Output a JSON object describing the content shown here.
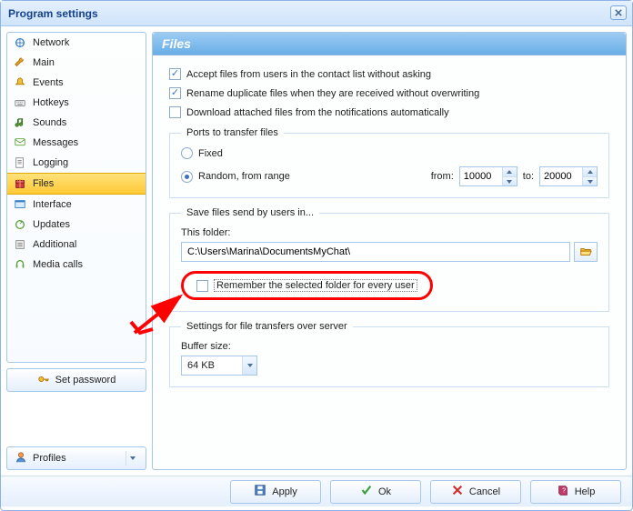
{
  "window": {
    "title": "Program settings"
  },
  "sidebar": {
    "items": [
      {
        "label": "Network"
      },
      {
        "label": "Main"
      },
      {
        "label": "Events"
      },
      {
        "label": "Hotkeys"
      },
      {
        "label": "Sounds"
      },
      {
        "label": "Messages"
      },
      {
        "label": "Logging"
      },
      {
        "label": "Files"
      },
      {
        "label": "Interface"
      },
      {
        "label": "Updates"
      },
      {
        "label": "Additional"
      },
      {
        "label": "Media calls"
      }
    ],
    "set_password": "Set password",
    "profiles": "Profiles"
  },
  "main": {
    "header": "Files",
    "accept_label": "Accept files from users in the contact list without asking",
    "rename_label": "Rename duplicate files when they are received without overwriting",
    "download_label": "Download attached files from the notifications automatically",
    "ports_legend": "Ports to transfer files",
    "fixed_label": "Fixed",
    "random_label": "Random, from range",
    "from_label": "from:",
    "to_label": "to:",
    "port_from": "10000",
    "port_to": "20000",
    "save_legend": "Save files send by users in...",
    "this_folder_label": "This folder:",
    "folder_value": "C:\\Users\\Marina\\DocumentsMyChat\\",
    "remember_label": "Remember the selected folder for every user",
    "transfer_legend": "Settings for file transfers over server",
    "buffer_label": "Buffer size:",
    "buffer_value": "64 KB"
  },
  "footer": {
    "apply": "Apply",
    "ok": "Ok",
    "cancel": "Cancel",
    "help": "Help"
  }
}
